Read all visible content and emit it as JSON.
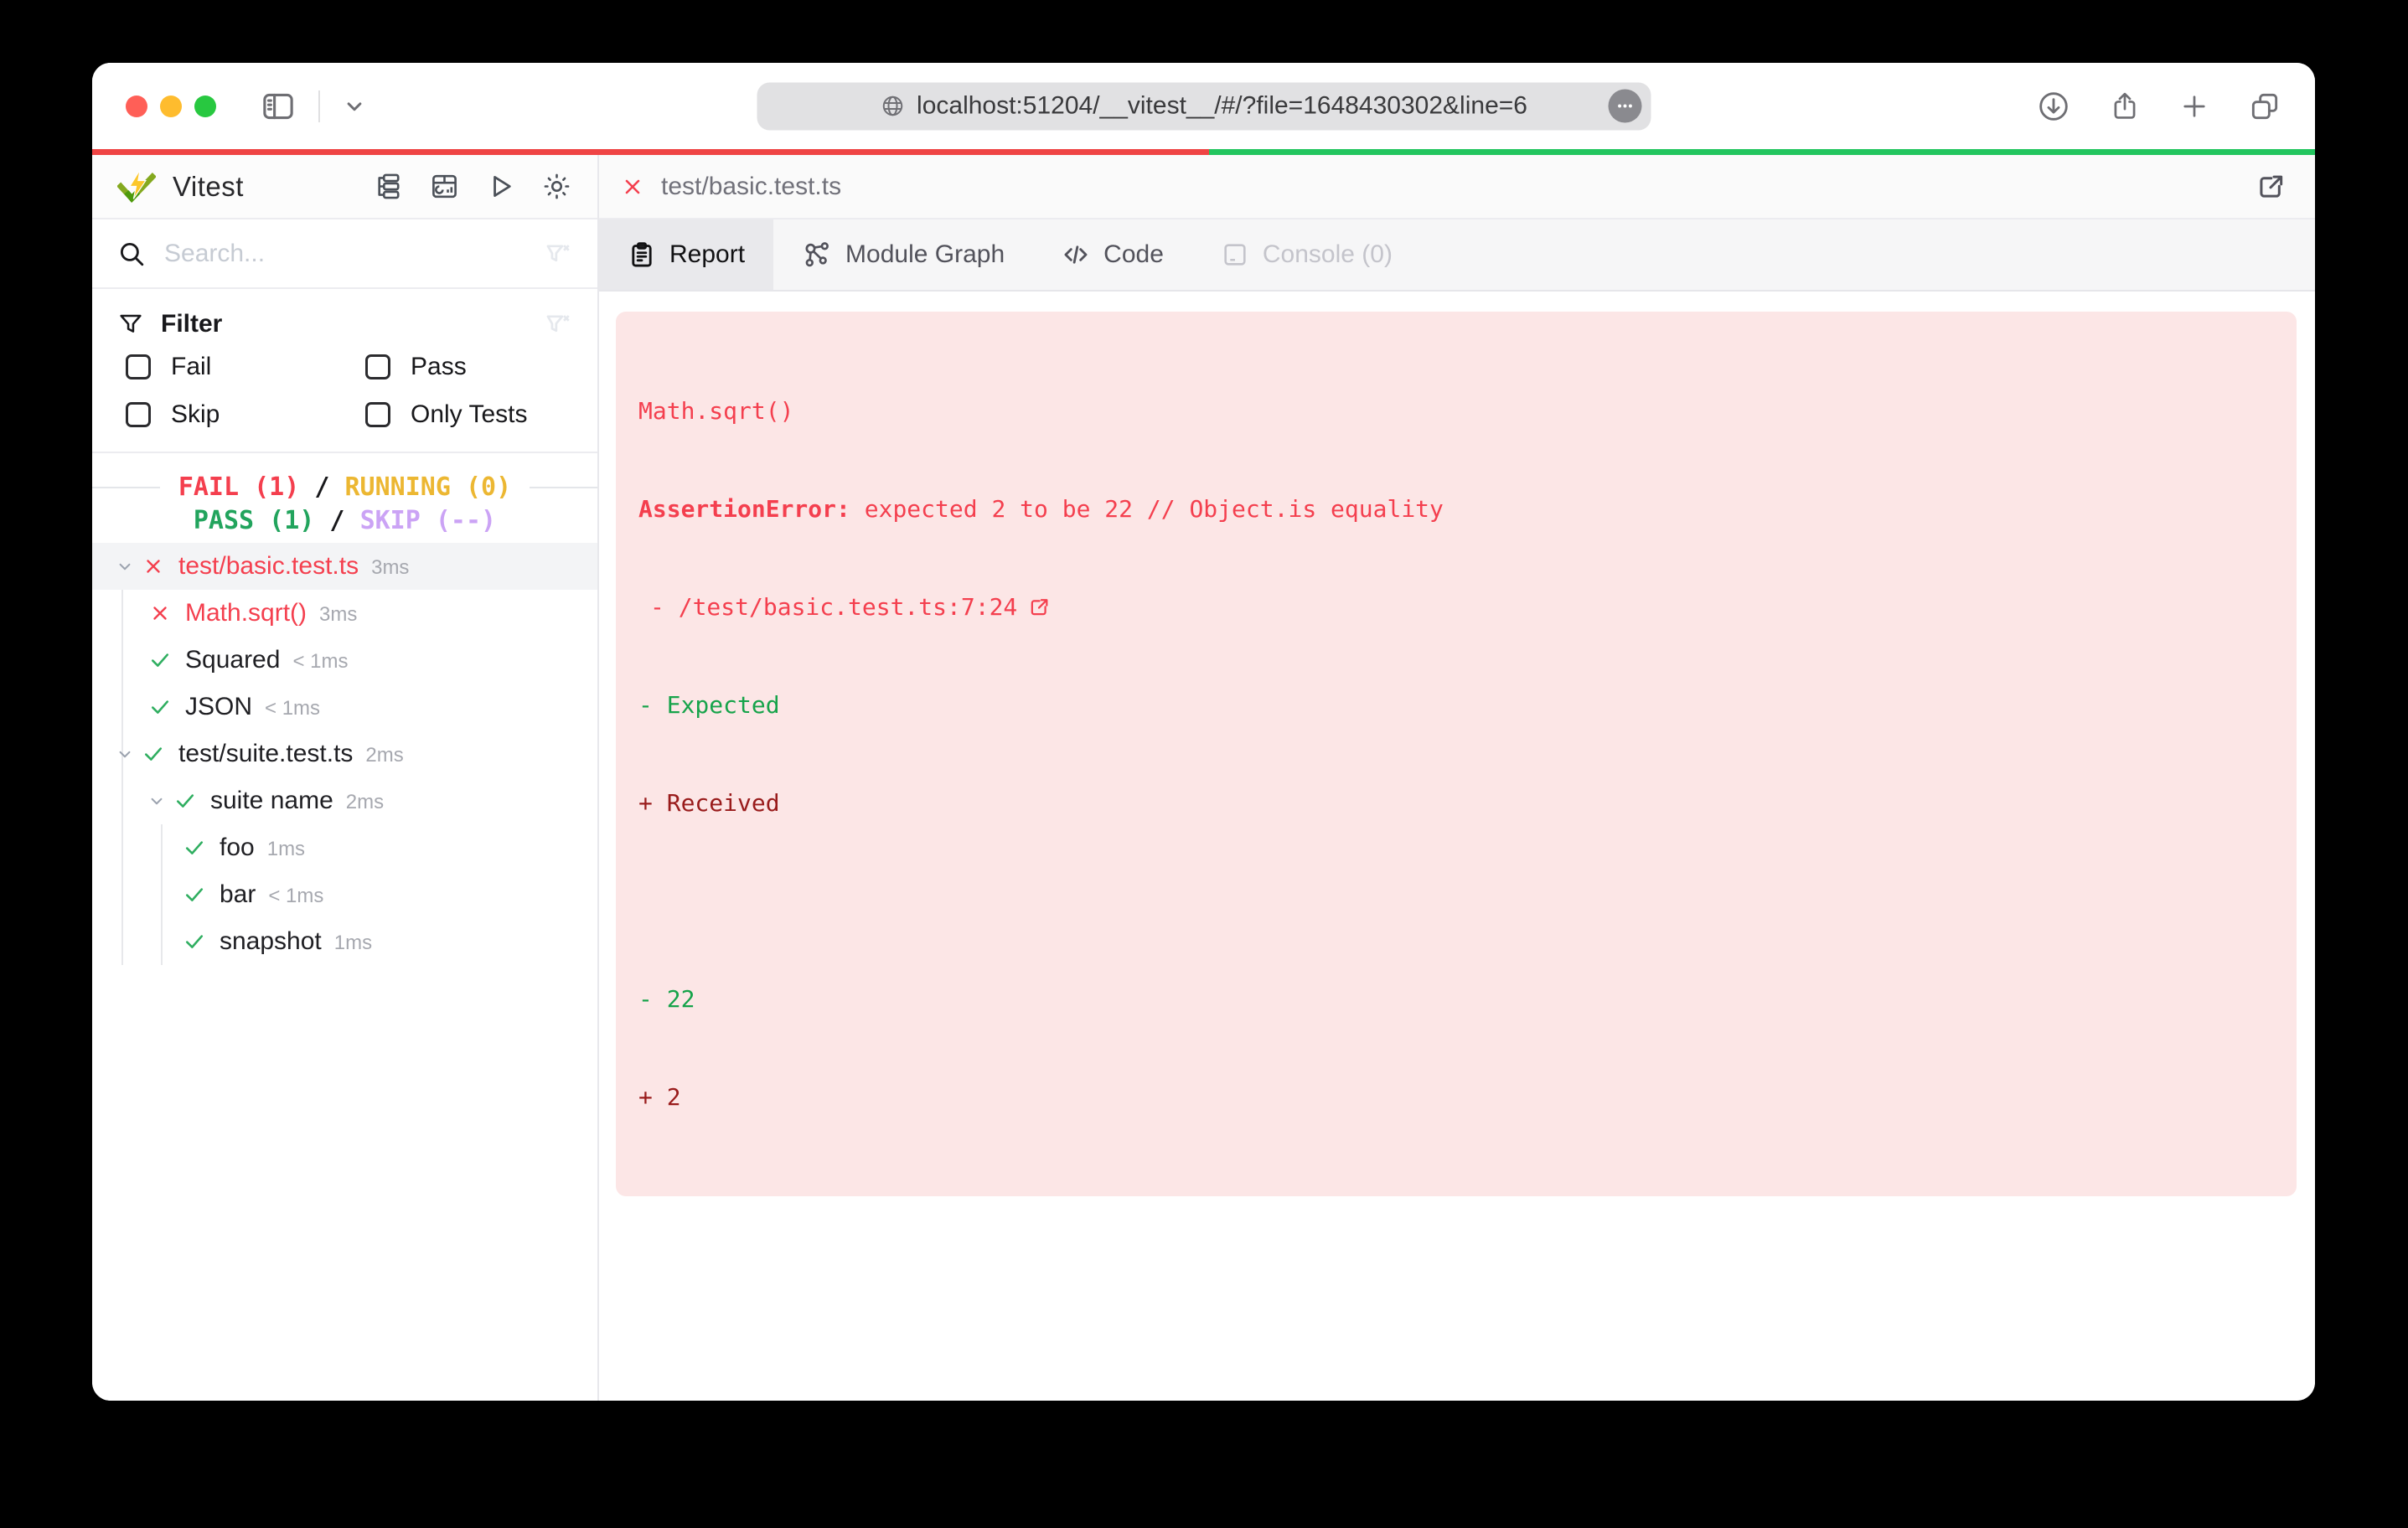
{
  "browser": {
    "url": "localhost:51204/__vitest__/#/?file=1648430302&line=6",
    "progress": {
      "fail_fraction": "50.25%",
      "fail_color": "#ef4444",
      "pass_color": "#22c55e"
    }
  },
  "sidebar": {
    "app_title": "Vitest",
    "search_placeholder": "Search...",
    "filter": {
      "title": "Filter",
      "options": [
        "Fail",
        "Pass",
        "Skip",
        "Only Tests"
      ]
    },
    "status": {
      "line1": {
        "fail": "FAIL (1)",
        "sep": " / ",
        "running": "RUNNING (0)"
      },
      "line2": {
        "pass": "PASS (1)",
        "sep": " / ",
        "skip": "SKIP (--)"
      }
    },
    "tree": [
      {
        "label": "test/basic.test.ts",
        "duration": "3ms",
        "status": "fail",
        "level": 0,
        "expanded": true,
        "selected": true
      },
      {
        "label": "Math.sqrt()",
        "duration": "3ms",
        "status": "fail",
        "level": 1
      },
      {
        "label": "Squared",
        "duration": "< 1ms",
        "status": "pass",
        "level": 1
      },
      {
        "label": "JSON",
        "duration": "< 1ms",
        "status": "pass",
        "level": 1
      },
      {
        "label": "test/suite.test.ts",
        "duration": "2ms",
        "status": "pass",
        "level": 0,
        "expanded": true
      },
      {
        "label": "suite name",
        "duration": "2ms",
        "status": "pass",
        "level": 1,
        "expanded": true
      },
      {
        "label": "foo",
        "duration": "1ms",
        "status": "pass",
        "level": 2
      },
      {
        "label": "bar",
        "duration": "< 1ms",
        "status": "pass",
        "level": 2
      },
      {
        "label": "snapshot",
        "duration": "1ms",
        "status": "pass",
        "level": 2
      }
    ]
  },
  "main": {
    "file_tab": "test/basic.test.ts",
    "tabs": [
      {
        "label": "Report",
        "active": true
      },
      {
        "label": "Module Graph"
      },
      {
        "label": "Code"
      },
      {
        "label": "Console (0)",
        "disabled": true
      }
    ],
    "error": {
      "title": "Math.sqrt()",
      "name": "AssertionError:",
      "message": " expected 2 to be 22 // Object.is equality",
      "stack": "- /test/basic.test.ts:7:24",
      "expected_label": "- Expected",
      "received_label": "+ Received",
      "expected_value": "- 22",
      "received_value": "+ 2"
    }
  },
  "colors": {
    "fail": "#f43f4e",
    "pass": "#22a45d",
    "running": "#ecb732",
    "skip": "#cba3f5",
    "progress_fail": "#ef4444",
    "progress_pass": "#22c55e",
    "error_bg": "#fce6e6",
    "diff_expected": "#16a34a",
    "diff_received": "#991b1b",
    "brand_green": "#729B1B",
    "brand_yellow": "#FCC72B"
  },
  "icons": {
    "chrome": [
      "sidebar-toggle-icon",
      "chevron-down-icon",
      "globe-icon",
      "ellipsis-icon",
      "download-icon",
      "share-icon",
      "new-tab-icon",
      "tab-overview-icon"
    ],
    "vitest_toolbar": [
      "tree-view-icon",
      "dashboard-icon",
      "run-all-icon",
      "theme-toggle-icon"
    ],
    "tabs": [
      "report-icon",
      "module-graph-icon",
      "code-icon",
      "console-icon"
    ]
  }
}
